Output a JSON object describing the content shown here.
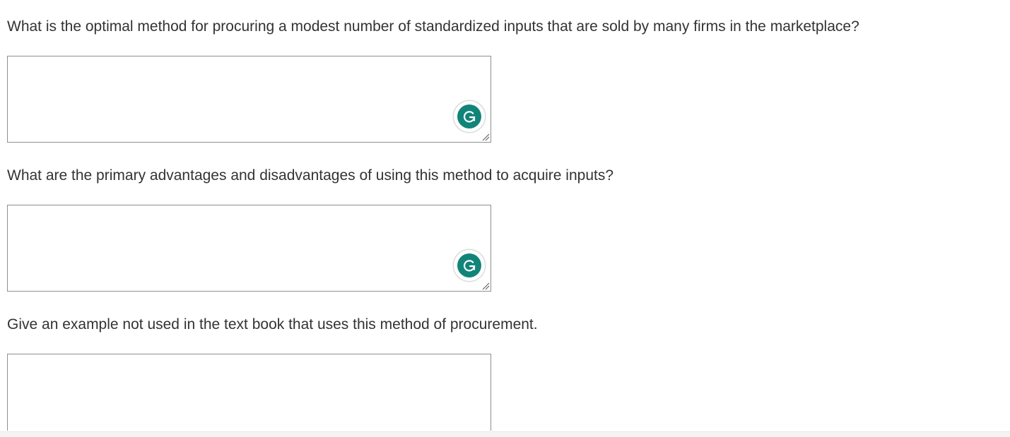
{
  "questions": [
    {
      "text": "What is the optimal method for procuring a modest number of standardized inputs that are sold by many firms in the marketplace?",
      "answer": "",
      "has_grammarly": true
    },
    {
      "text": "What are the primary advantages and disadvantages of using this method to acquire inputs?",
      "answer": "",
      "has_grammarly": true
    },
    {
      "text": "Give an example not used in the text book that uses this method of procurement.",
      "answer": "",
      "has_grammarly": false
    }
  ],
  "icons": {
    "grammarly": "grammarly-g-icon",
    "resize": "resize-grip-icon"
  },
  "colors": {
    "text": "#333333",
    "box_border": "#8f8f8f",
    "grammarly_green": "#11847a"
  }
}
